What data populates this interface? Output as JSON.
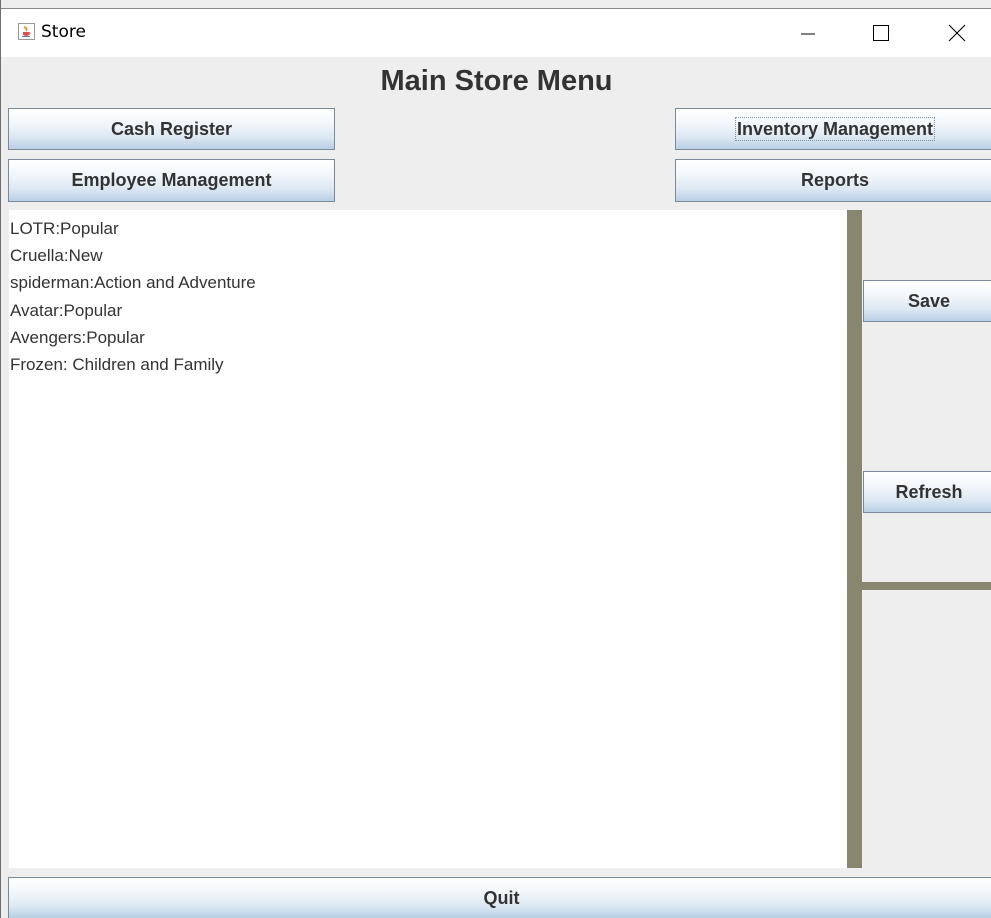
{
  "window": {
    "title": "Store"
  },
  "header": {
    "title": "Main Store Menu"
  },
  "nav": {
    "cash_register": "Cash Register",
    "inventory_management": "Inventory Management",
    "employee_management": "Employee Management",
    "reports": "Reports"
  },
  "inventory_list": {
    "lines": [
      "LOTR:Popular",
      "Cruella:New",
      "spiderman:Action and Adventure",
      "Avatar:Popular",
      "Avengers:Popular",
      "Frozen: Children and Family"
    ]
  },
  "side_panel": {
    "save_label": "Save",
    "refresh_label": "Refresh"
  },
  "footer": {
    "quit_label": "Quit"
  },
  "colors": {
    "background": "#eeeeee",
    "text": "#333333",
    "divider": "#878770",
    "button_border": "#7a8a99"
  },
  "icons": {
    "app": "java-cup-icon",
    "minimize": "minimize-icon",
    "maximize": "maximize-icon",
    "close": "close-icon"
  }
}
